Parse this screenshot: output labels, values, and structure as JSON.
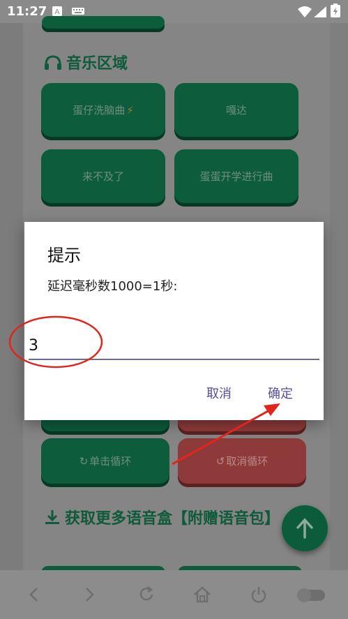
{
  "status_bar": {
    "time": "11:27"
  },
  "music_section": {
    "title": "音乐区域",
    "buttons": [
      "蛋仔洗脑曲",
      "嘎达",
      "来不及了",
      "蛋蛋开学进行曲"
    ]
  },
  "controls": {
    "single_loop_label": "单击循环",
    "cancel_loop_label": "取消循环"
  },
  "voicebox_section": {
    "title": "获取更多语音盒【附赠语音包】"
  },
  "dialog": {
    "title": "提示",
    "message": "延迟毫秒数1000=1秒:",
    "input_value": "3",
    "cancel_label": "取消",
    "confirm_label": "确定"
  },
  "colors": {
    "accent_green": "#0d5c3c",
    "accent_red": "#8e3a3a",
    "annotation_red": "#e0261c",
    "dialog_button": "#5a4a9a"
  },
  "icons": [
    "headphones-icon",
    "lightning-icon",
    "refresh-icon",
    "undo-icon",
    "download-icon",
    "arrow-up-icon",
    "back-icon",
    "forward-icon",
    "reload-icon",
    "home-icon",
    "power-icon",
    "toggle-icon"
  ]
}
